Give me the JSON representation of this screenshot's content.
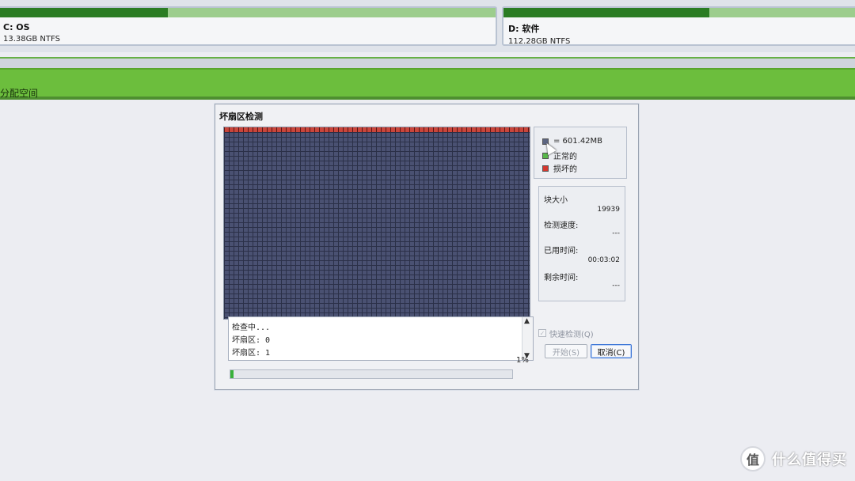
{
  "partitions": [
    {
      "name": "C: OS",
      "size": "13.38GB NTFS"
    },
    {
      "name": "D: 软件",
      "size": "112.28GB NTFS"
    }
  ],
  "unallocated_label": "分配空间",
  "dialog": {
    "title": "坏扇区检测",
    "legend": {
      "block_size": "= 601.42MB",
      "normal": "正常的",
      "bad": "损坏的"
    },
    "info": {
      "block_size_label": "块大小",
      "block_size_value": "19939",
      "speed_label": "检测速度:",
      "speed_value": "---",
      "elapsed_label": "已用时间:",
      "elapsed_value": "00:03:02",
      "remaining_label": "剩余时间:",
      "remaining_value": "---"
    },
    "log": [
      "检查中...",
      "坏扇区: 0",
      "坏扇区: 1"
    ],
    "progress": {
      "percent_text": "1%",
      "value": 0.01
    },
    "quick_check_label": "快速检测(Q)",
    "start_button": "开始(S)",
    "cancel_button": "取消(C)"
  },
  "watermark": {
    "logo": "值",
    "text": "什么值得买"
  },
  "colors": {
    "unallocated": "#6cbe3d",
    "grid_block": "#4a5172",
    "bad_block": "#c9463c",
    "progress": "#38b13a"
  }
}
